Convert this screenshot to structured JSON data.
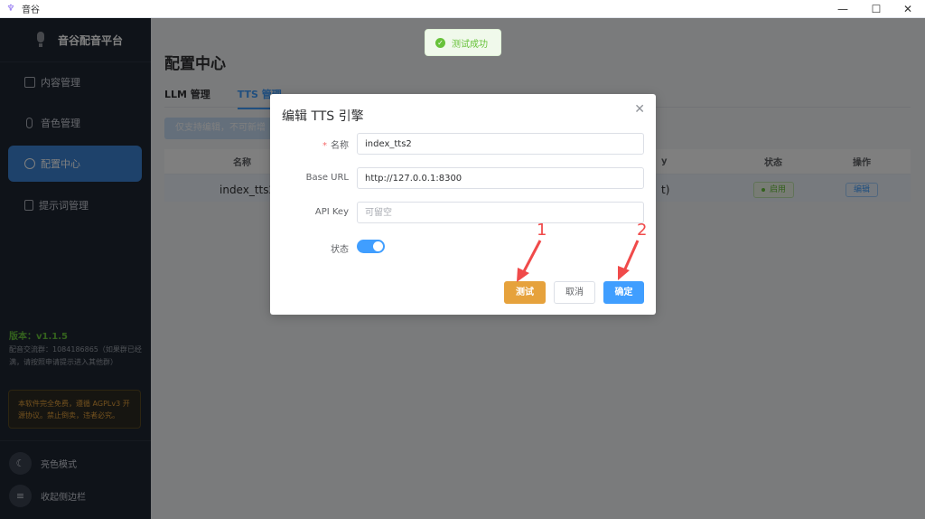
{
  "window": {
    "title": "音谷",
    "icon": "app-icon",
    "controls": [
      "minimize",
      "maximize",
      "close"
    ]
  },
  "sidebar": {
    "brand": "音谷配音平台",
    "items": [
      {
        "label": "内容管理",
        "icon": "folder-icon"
      },
      {
        "label": "音色管理",
        "icon": "mic-icon"
      },
      {
        "label": "配置中心",
        "icon": "gear-icon",
        "active": true
      },
      {
        "label": "提示词管理",
        "icon": "document-icon"
      }
    ],
    "version": "版本：v1.1.5",
    "group_text": "配音交流群：1084186865（如果群已经满，请按照申请提示进入其他群）",
    "notice": "本软件完全免费，遵循 AGPLv3 开源协议。禁止倒卖，违者必究。",
    "theme_toggle": "亮色模式",
    "collapse": "收起侧边栏"
  },
  "main": {
    "title": "配置中心",
    "tabs": [
      {
        "label": "LLM 管理"
      },
      {
        "label": "TTS 管理",
        "active": true
      }
    ],
    "info": "仅支持编辑，不可新增",
    "table": {
      "headers": {
        "name": "名称",
        "key": "y",
        "status": "状态",
        "op": "操作"
      },
      "rows": [
        {
          "name": "index_tts2",
          "key": "t)",
          "status": "启用",
          "op": "编辑"
        }
      ]
    }
  },
  "toast": {
    "text": "测试成功"
  },
  "dialog": {
    "title": "编辑 TTS 引擎",
    "fields": {
      "name": {
        "label": "名称",
        "required": "*",
        "value": "index_tts2"
      },
      "base_url": {
        "label": "Base URL",
        "value": "http://127.0.0.1:8300"
      },
      "api_key": {
        "label": "API Key",
        "value": "",
        "placeholder": "可留空"
      },
      "status": {
        "label": "状态",
        "on": true
      }
    },
    "buttons": {
      "test": "测试",
      "cancel": "取消",
      "ok": "确定"
    }
  },
  "annotations": [
    {
      "number": "1"
    },
    {
      "number": "2"
    }
  ],
  "colors": {
    "primary": "#409eff",
    "warning": "#e6a23c",
    "success": "#67c23a",
    "annotation": "#f04a4a",
    "sidebar_bg": "#1f2733"
  }
}
